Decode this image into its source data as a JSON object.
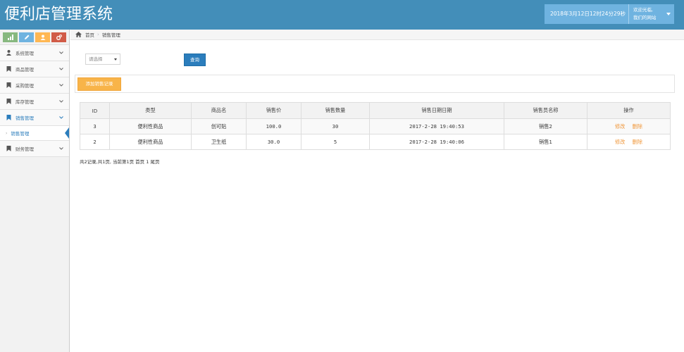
{
  "header": {
    "title": "便利店管理系统",
    "datetime": "2018年3月12日12时24分29秒",
    "welcome_line1": "欢迎光临,",
    "welcome_line2": "我们的网站"
  },
  "colors": {
    "header_bg": "#438eb9",
    "primary": "#2b7dbc",
    "warning": "#f8b449",
    "link_orange": "#f0983c",
    "shortcut_colors": [
      "#87b87f",
      "#6fb3e0",
      "#ffb752",
      "#d15b47"
    ]
  },
  "shortcuts": [
    {
      "icon": "signal-icon"
    },
    {
      "icon": "pencil-icon"
    },
    {
      "icon": "users-icon"
    },
    {
      "icon": "cogs-icon"
    }
  ],
  "sidebar": {
    "items": [
      {
        "label": "系统管理",
        "icon": "user-icon"
      },
      {
        "label": "商品管理",
        "icon": "bookmark-icon"
      },
      {
        "label": "采购管理",
        "icon": "bookmark-icon"
      },
      {
        "label": "库存管理",
        "icon": "bookmark-icon"
      },
      {
        "label": "销售管理",
        "icon": "bookmark-icon",
        "active": true
      },
      {
        "label": "财务管理",
        "icon": "bookmark-icon"
      }
    ],
    "submenu": {
      "label": "销售管理"
    }
  },
  "breadcrumb": {
    "home": "首页",
    "current": "销售管理"
  },
  "search": {
    "select_value": "请选择",
    "query_label": "查询"
  },
  "actions": {
    "add_label": "添加销售记录"
  },
  "table": {
    "headers": [
      "ID",
      "类型",
      "商品名",
      "销售价",
      "销售数量",
      "销售日期日期",
      "销售员名称",
      "操作"
    ],
    "rows": [
      {
        "id": "3",
        "type": "便利性商品",
        "name": "创可贴",
        "price": "100.0",
        "qty": "30",
        "date": "2017-2-28 19:40:53",
        "seller": "销售2"
      },
      {
        "id": "2",
        "type": "便利性商品",
        "name": "卫生纸",
        "price": "30.0",
        "qty": "5",
        "date": "2017-2-28 19:40:06",
        "seller": "销售1"
      }
    ],
    "edit_label": "修改",
    "delete_label": "删除"
  },
  "pager": {
    "text": "共2记录,共1页, 当前第1页 首页 1 尾页"
  }
}
